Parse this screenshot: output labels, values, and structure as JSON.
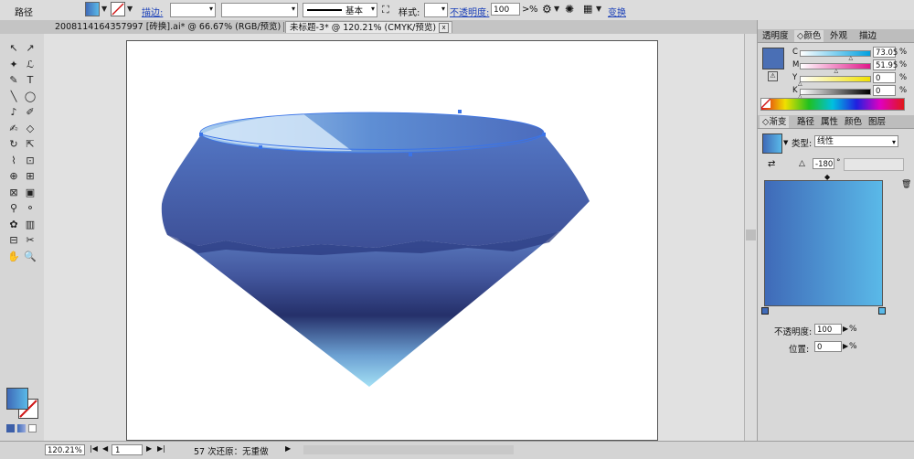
{
  "control_bar": {
    "object_type": "路径",
    "stroke_label": "描边:",
    "stroke_weight": "",
    "brush_value": "",
    "profile_label": "基本",
    "style_label": "样式:",
    "opacity_label": "不透明度:",
    "opacity_value": "100",
    "opacity_arrow": ">",
    "opacity_unit": "%",
    "transform_label": "变换",
    "fill_color": "#5b8fd6",
    "stroke_none_color": "#d01818"
  },
  "doc_tabs": [
    {
      "label": "2008114164357997 [砖换].ai* @ 66.67% (RGB/预览)",
      "close": "x"
    },
    {
      "label": "未标题-3* @ 120.21% (CMYK/预览)",
      "close": "x"
    }
  ],
  "status_bar": {
    "zoom": "120.21%",
    "page": "1",
    "undo_text": "57 次还原：无重做",
    "arrow": "▶"
  },
  "color_panel": {
    "tabs": [
      "透明度",
      "颜色",
      "外观",
      "描边"
    ],
    "active_tab": "颜色",
    "swatch_color": "#4a6fb5",
    "channels": [
      {
        "label": "C",
        "value": "73.05",
        "unit": "%"
      },
      {
        "label": "M",
        "value": "51.95",
        "unit": "%"
      },
      {
        "label": "Y",
        "value": "0",
        "unit": "%"
      },
      {
        "label": "K",
        "value": "0",
        "unit": "%"
      }
    ]
  },
  "gradient_panel": {
    "tabs": [
      "渐变",
      "路径",
      "属性",
      "颜色",
      "图层"
    ],
    "active_tab": "渐变",
    "type_label": "类型:",
    "type_value": "线性",
    "angle_value": "-180",
    "angle_unit": "°",
    "stop_start_color": "#3f6ab8",
    "stop_end_color": "#5ab9e8",
    "opacity_label": "不透明度:",
    "opacity_value": "100",
    "opacity_unit": "%",
    "position_label": "位置:",
    "position_value": "0",
    "position_unit": "%"
  },
  "tools": [
    "selection-tool",
    "direct-selection-tool",
    "magic-wand-tool",
    "lasso-tool",
    "pen-tool",
    "type-tool",
    "line-tool",
    "ellipse-tool",
    "paintbrush-tool",
    "pencil-tool",
    "blob-brush-tool",
    "eraser-tool",
    "rotate-tool",
    "scale-tool",
    "warp-tool",
    "free-transform-tool",
    "shape-builder-tool",
    "perspective-tool",
    "mesh-tool",
    "gradient-tool",
    "eyedropper-tool",
    "blend-tool",
    "symbol-sprayer-tool",
    "column-graph-tool",
    "artboard-tool",
    "slice-tool",
    "hand-tool",
    "zoom-tool"
  ],
  "tool_glyphs": [
    "↖",
    "↗",
    "✦",
    "ℒ",
    "✎",
    "T",
    "╲",
    "◯",
    "♪",
    "✐",
    "✍",
    "◇",
    "↻",
    "⇱",
    "⌇",
    "⊡",
    "⊕",
    "⊞",
    "⊠",
    "▣",
    "⚲",
    "⚬",
    "✿",
    "▥",
    "⊟",
    "✂",
    "✋",
    "🔍"
  ],
  "colors": {
    "gem_top_light": "#a9c8ea",
    "gem_mid": "#4e6bb5",
    "gem_dark": "#26336d",
    "gem_tip": "#98d8f2"
  }
}
